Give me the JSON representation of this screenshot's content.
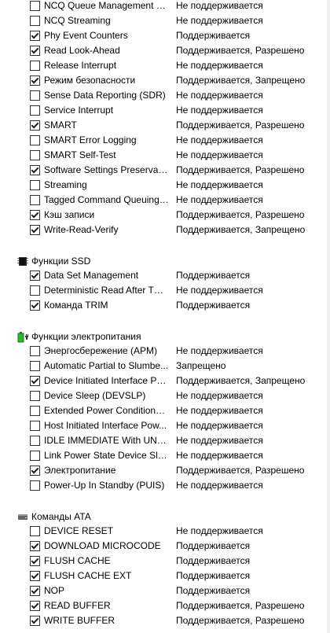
{
  "sections": [
    {
      "title": "",
      "icon": "",
      "items": [
        {
          "name": "NCQ Queue Management C...",
          "value": "Не поддерживается",
          "checked": false
        },
        {
          "name": "NCQ Streaming",
          "value": "Не поддерживается",
          "checked": false
        },
        {
          "name": "Phy Event Counters",
          "value": "Поддерживается",
          "checked": true
        },
        {
          "name": "Read Look-Ahead",
          "value": "Поддерживается, Разрешено",
          "checked": true
        },
        {
          "name": "Release Interrupt",
          "value": "Не поддерживается",
          "checked": false
        },
        {
          "name": "Режим безопасности",
          "value": "Поддерживается, Запрещено",
          "checked": true
        },
        {
          "name": "Sense Data Reporting (SDR)",
          "value": "Не поддерживается",
          "checked": false
        },
        {
          "name": "Service Interrupt",
          "value": "Не поддерживается",
          "checked": false
        },
        {
          "name": "SMART",
          "value": "Поддерживается, Разрешено",
          "checked": true
        },
        {
          "name": "SMART Error Logging",
          "value": "Не поддерживается",
          "checked": false
        },
        {
          "name": "SMART Self-Test",
          "value": "Не поддерживается",
          "checked": false
        },
        {
          "name": "Software Settings Preservati...",
          "value": "Поддерживается, Разрешено",
          "checked": true
        },
        {
          "name": "Streaming",
          "value": "Не поддерживается",
          "checked": false
        },
        {
          "name": "Tagged Command Queuing ...",
          "value": "Не поддерживается",
          "checked": false
        },
        {
          "name": "Кэш записи",
          "value": "Поддерживается, Разрешено",
          "checked": true
        },
        {
          "name": "Write-Read-Verify",
          "value": "Поддерживается, Запрещено",
          "checked": true
        }
      ]
    },
    {
      "title": "Функции SSD",
      "icon": "ssd-chip-icon",
      "items": [
        {
          "name": "Data Set Management",
          "value": "Поддерживается",
          "checked": true
        },
        {
          "name": "Deterministic Read After TRIM",
          "value": "Не поддерживается",
          "checked": false
        },
        {
          "name": "Команда TRIM",
          "value": "Поддерживается",
          "checked": true
        }
      ]
    },
    {
      "title": "Функции электропитания",
      "icon": "battery-plug-icon",
      "items": [
        {
          "name": "Энергосбережение (APM)",
          "value": "Не поддерживается",
          "checked": false
        },
        {
          "name": "Automatic Partial to Slumbe...",
          "value": "Запрещено",
          "checked": false
        },
        {
          "name": "Device Initiated Interface Po...",
          "value": "Поддерживается, Запрещено",
          "checked": true
        },
        {
          "name": "Device Sleep (DEVSLP)",
          "value": "Не поддерживается",
          "checked": false
        },
        {
          "name": "Extended Power Conditions ...",
          "value": "Не поддерживается",
          "checked": false
        },
        {
          "name": "Host Initiated Interface Pow...",
          "value": "Не поддерживается",
          "checked": false
        },
        {
          "name": "IDLE IMMEDIATE With UNLO...",
          "value": "Не поддерживается",
          "checked": false
        },
        {
          "name": "Link Power State Device Sleep",
          "value": "Не поддерживается",
          "checked": false
        },
        {
          "name": "Электропитание",
          "value": "Поддерживается, Разрешено",
          "checked": true
        },
        {
          "name": "Power-Up In Standby (PUIS)",
          "value": "Не поддерживается",
          "checked": false
        }
      ]
    },
    {
      "title": "Команды ATA",
      "icon": "drive-icon",
      "items": [
        {
          "name": "DEVICE RESET",
          "value": "Не поддерживается",
          "checked": false
        },
        {
          "name": "DOWNLOAD MICROCODE",
          "value": "Поддерживается",
          "checked": true
        },
        {
          "name": "FLUSH CACHE",
          "value": "Поддерживается",
          "checked": true
        },
        {
          "name": "FLUSH CACHE EXT",
          "value": "Поддерживается",
          "checked": true
        },
        {
          "name": "NOP",
          "value": "Поддерживается",
          "checked": true
        },
        {
          "name": "READ BUFFER",
          "value": "Поддерживается, Разрешено",
          "checked": true
        },
        {
          "name": "WRITE BUFFER",
          "value": "Поддерживается, Разрешено",
          "checked": true
        }
      ]
    }
  ]
}
